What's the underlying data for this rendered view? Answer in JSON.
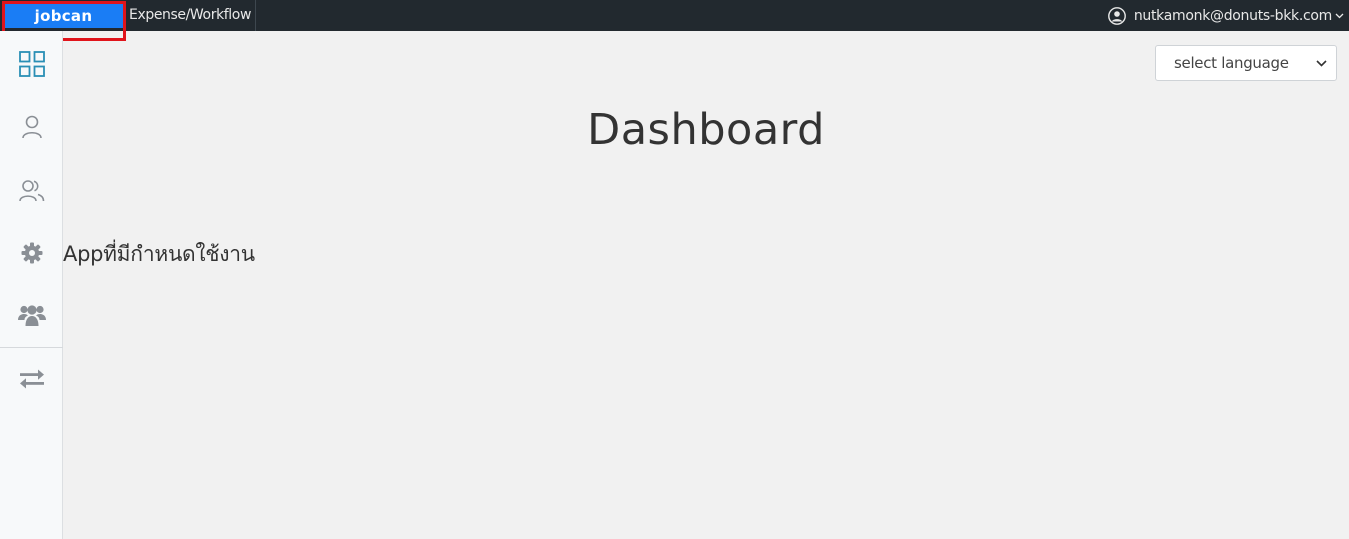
{
  "topbar": {
    "brand": "jobcan",
    "app_name": "Expense/Workflow",
    "user_email": "nutkamonk@donuts-bkk.com"
  },
  "sidebar": {
    "items": [
      {
        "icon": "dashboard-grid-icon"
      },
      {
        "icon": "user-icon"
      },
      {
        "icon": "users-icon"
      },
      {
        "icon": "gear-icon"
      },
      {
        "icon": "group-icon"
      },
      {
        "icon": "swap-arrows-icon"
      }
    ]
  },
  "language_select": {
    "value": "select language"
  },
  "main": {
    "title": "Dashboard",
    "apps_label": "Appที่มีกำหนดใช้งาน"
  },
  "colors": {
    "topbar_bg": "#22292f",
    "brand_bg": "#1a7df5",
    "highlight": "#e0141b",
    "dashboard_icon": "#2a8fb5",
    "sidebar_icon": "#8a8f95"
  }
}
